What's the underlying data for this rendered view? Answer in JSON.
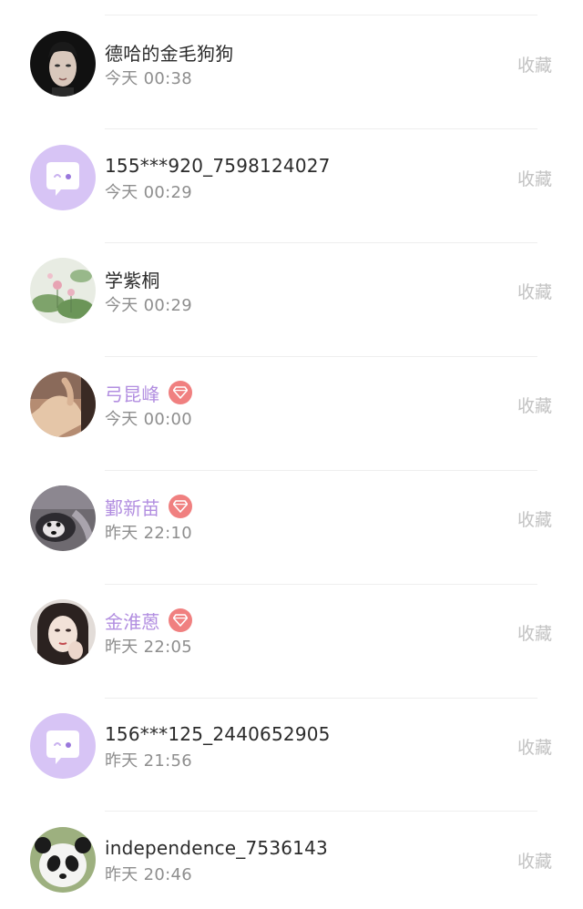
{
  "contacts": [
    {
      "name": "德哈的金毛狗狗",
      "time": "今天 00:38",
      "action": "收藏",
      "vip": false,
      "avatar": "man-portrait"
    },
    {
      "name": "155***920_7598124027",
      "time": "今天 00:29",
      "action": "收藏",
      "vip": false,
      "avatar": "chat-bubble-default"
    },
    {
      "name": "学紫桐",
      "time": "今天 00:29",
      "action": "收藏",
      "vip": false,
      "avatar": "lotus-painting"
    },
    {
      "name": "弓昆峰",
      "time": "今天 00:00",
      "action": "收藏",
      "vip": true,
      "avatar": "hand-photo"
    },
    {
      "name": "鄞新苗",
      "time": "昨天 22:10",
      "action": "收藏",
      "vip": true,
      "avatar": "dog-photo"
    },
    {
      "name": "金淮蒽",
      "time": "昨天 22:05",
      "action": "收藏",
      "vip": true,
      "avatar": "woman-portrait"
    },
    {
      "name": "156***125_2440652905",
      "time": "昨天 21:56",
      "action": "收藏",
      "vip": false,
      "avatar": "chat-bubble-default"
    },
    {
      "name": "independence_7536143",
      "time": "昨天 20:46",
      "action": "收藏",
      "vip": false,
      "avatar": "panda-photo"
    }
  ],
  "colors": {
    "vip_name": "#b28ee0",
    "vip_badge": "#f08080",
    "default_avatar_bg": "#d7c4f5",
    "action_text": "#c2c2c2"
  }
}
